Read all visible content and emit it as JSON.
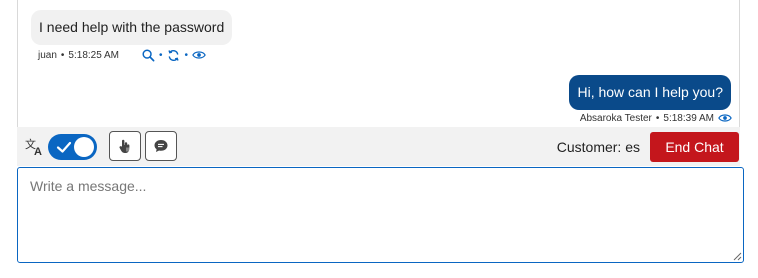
{
  "messages": {
    "incoming": {
      "text": "I need help with the password",
      "author": "juan",
      "time": "5:18:25 AM",
      "separator": "•",
      "icons": [
        "search-icon",
        "sync-icon",
        "eye-icon"
      ]
    },
    "outgoing": {
      "text": "Hi, how can I help you?",
      "author": "Absaroka Tester",
      "time": "5:18:39 AM",
      "separator": "•",
      "icons": [
        "eye-icon"
      ]
    }
  },
  "toolbar": {
    "translate_toggle_on": true,
    "customer_language": "Customer: es",
    "end_chat_label": "End Chat"
  },
  "composer": {
    "placeholder": "Write a message...",
    "value": ""
  },
  "colors": {
    "accent": "#0a66c2",
    "outgoing_bubble": "#0a4a8a",
    "incoming_bubble": "#f1f1f1",
    "danger": "#c4161c",
    "toolbar_bg": "#f2f2f2"
  }
}
